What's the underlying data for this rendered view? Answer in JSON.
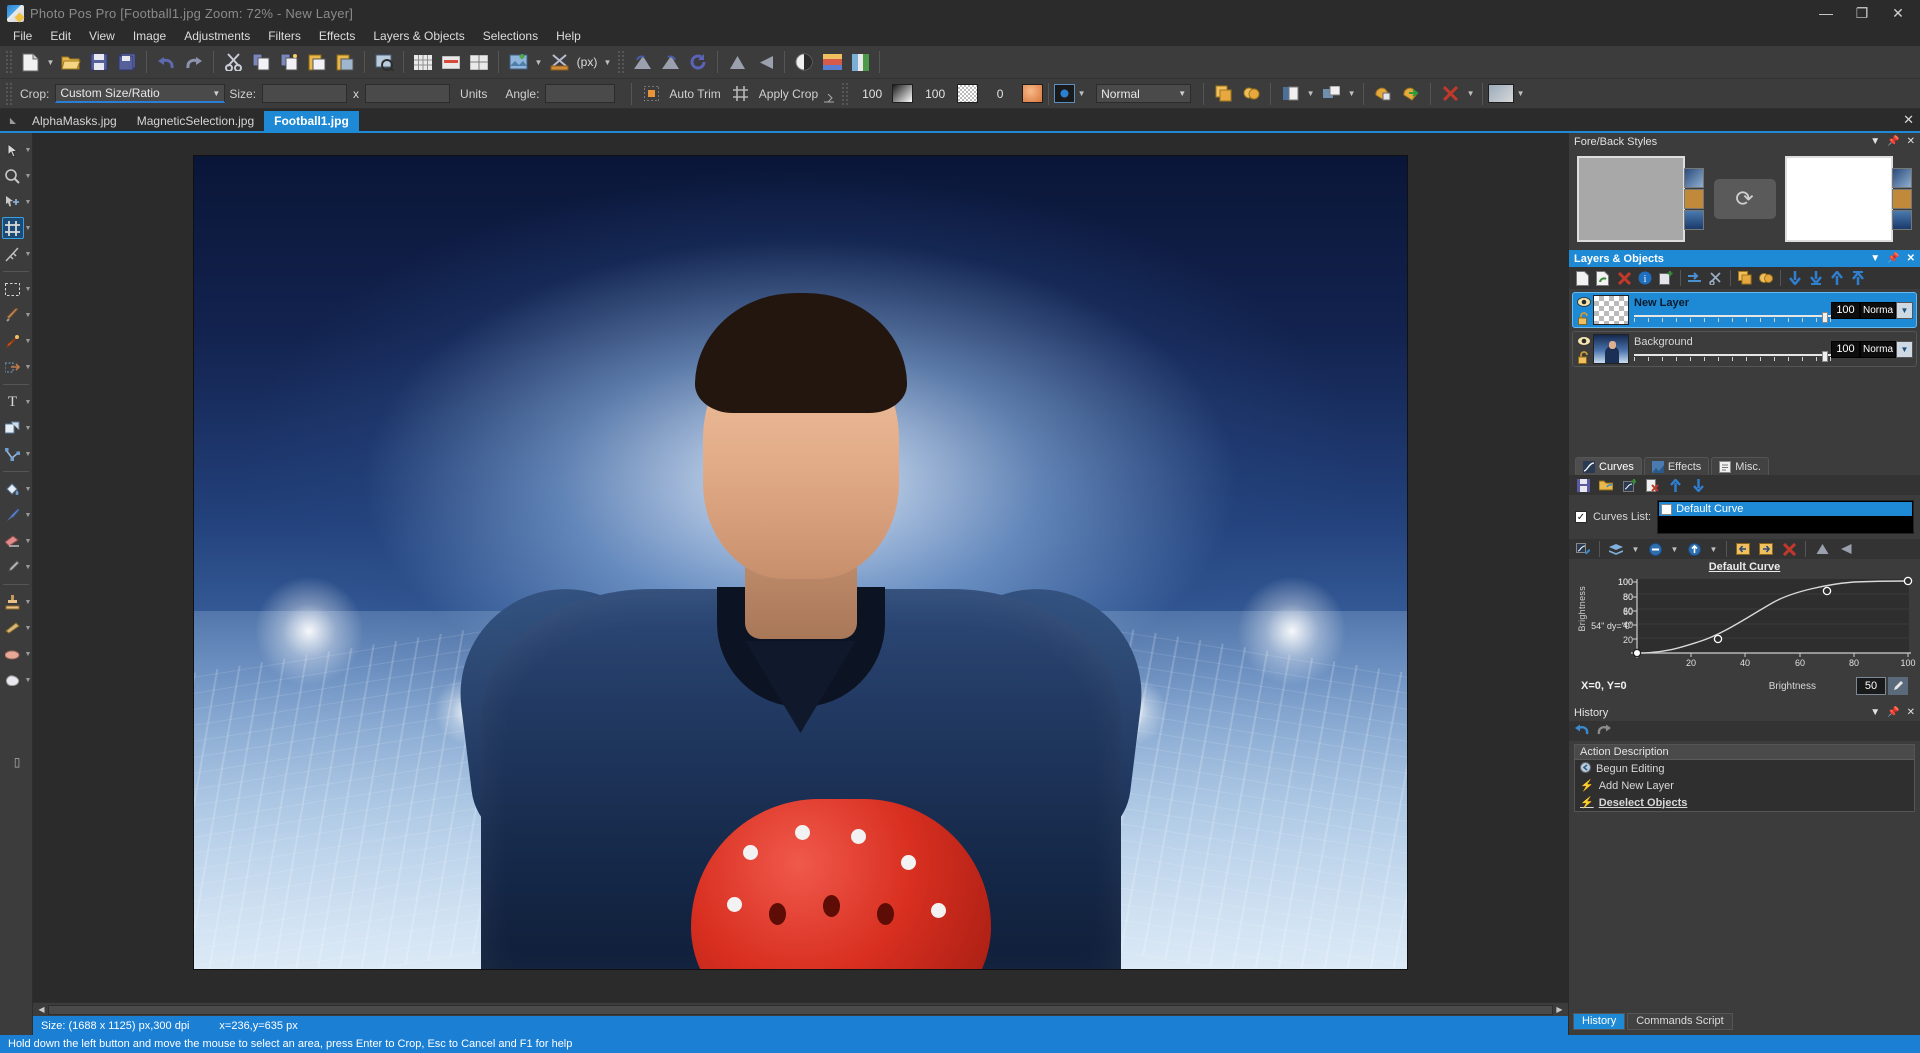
{
  "window": {
    "title": "Photo Pos Pro [Football1.jpg Zoom: 72% - New Layer]",
    "logo_icon": "app-logo-icon",
    "minimize": "—",
    "maximize": "❐",
    "close": "✕"
  },
  "menubar": {
    "items": [
      {
        "label": "File"
      },
      {
        "label": "Edit"
      },
      {
        "label": "View"
      },
      {
        "label": "Image"
      },
      {
        "label": "Adjustments"
      },
      {
        "label": "Filters"
      },
      {
        "label": "Effects"
      },
      {
        "label": "Layers & Objects"
      },
      {
        "label": "Selections"
      },
      {
        "label": "Help"
      }
    ]
  },
  "main_toolbar": {
    "buttons": [
      {
        "name": "new-file-icon",
        "glyph": "📄"
      },
      {
        "name": "open-file-icon",
        "glyph": "📂"
      },
      {
        "name": "save-icon",
        "glyph": "💾"
      },
      {
        "name": "save-as-icon",
        "glyph": "🗄"
      },
      {
        "name": "undo-icon",
        "glyph": "↶"
      },
      {
        "name": "redo-icon",
        "glyph": "↷"
      },
      {
        "name": "cut-icon",
        "glyph": "✂"
      },
      {
        "name": "copy-icon",
        "glyph": "📋"
      },
      {
        "name": "copy-merged-icon",
        "glyph": "📑"
      },
      {
        "name": "paste-icon",
        "glyph": "📌"
      },
      {
        "name": "paste-into-icon",
        "glyph": "📎"
      },
      {
        "name": "print-preview-icon",
        "glyph": "🔍"
      },
      {
        "name": "grid-icon",
        "glyph": "▦"
      },
      {
        "name": "ruler-icon",
        "glyph": "▭"
      },
      {
        "name": "guides-icon",
        "glyph": "⊞"
      },
      {
        "name": "image-effects-icon",
        "glyph": "🖼"
      },
      {
        "name": "crop-tool-icon",
        "glyph": "✂"
      },
      {
        "name": "units-px-icon",
        "glyph": "(px)"
      },
      {
        "name": "flip-rotate-icon",
        "glyph": "◣"
      },
      {
        "name": "rotate-left-icon",
        "glyph": "◢"
      },
      {
        "name": "rotate-cw-icon",
        "glyph": "↻"
      },
      {
        "name": "flip-vertical-icon",
        "glyph": "▲"
      },
      {
        "name": "flip-horizontal-icon",
        "glyph": "◀"
      },
      {
        "name": "contrast-icon",
        "glyph": "◐"
      },
      {
        "name": "gradient-icon",
        "glyph": "▬"
      },
      {
        "name": "color-balance-icon",
        "glyph": "▥"
      }
    ],
    "units_label": "(px)"
  },
  "crop_bar": {
    "crop_label": "Crop:",
    "crop_mode": "Custom Size/Ratio",
    "size_label": "Size:",
    "size_width": "",
    "size_x": "x",
    "size_height": "",
    "units_label": "Units",
    "angle_label": "Angle:",
    "angle_value": "",
    "auto_trim_label": "Auto Trim",
    "auto_trim_icon": "auto-trim-icon",
    "apply_crop_label": "Apply Crop",
    "apply_crop_icon": "apply-crop-icon",
    "opacity_value": "100",
    "feather_value": "100",
    "tolerance_value": "0",
    "blend_mode": "Normal",
    "fg_swatch": "#dfe8f0",
    "pattern_swatch": "#cfcfcf",
    "color_swatch": "#e8955a",
    "mask_swatch": "#2b7fd0",
    "right_icons": [
      {
        "name": "duplicate-selection-icon",
        "glyph": "⧉"
      },
      {
        "name": "merge-selection-icon",
        "glyph": "◓"
      },
      {
        "name": "selection-to-layer-icon",
        "glyph": "◧"
      },
      {
        "name": "transform-selection-icon",
        "glyph": "▣"
      },
      {
        "name": "save-selection-icon",
        "glyph": "💾"
      },
      {
        "name": "load-selection-icon",
        "glyph": "➜"
      },
      {
        "name": "delete-selection-icon",
        "glyph": "✕"
      },
      {
        "name": "selection-preview-icon",
        "glyph": "▨"
      }
    ]
  },
  "document_tabs": {
    "scroll_left_icon": "scroll-left-icon",
    "tabs": [
      {
        "label": "AlphaMasks.jpg",
        "active": false
      },
      {
        "label": "MagneticSelection.jpg",
        "active": false
      },
      {
        "label": "Football1.jpg",
        "active": true
      }
    ],
    "close_icon": "close-document-icon"
  },
  "tools": [
    {
      "name": "move-tool",
      "glyph": "⬉",
      "selected": false,
      "has_arrow": true
    },
    {
      "name": "zoom-tool",
      "glyph": "🔍",
      "selected": false,
      "has_arrow": true
    },
    {
      "name": "pan-tool",
      "glyph": "✥",
      "selected": false,
      "has_arrow": true
    },
    {
      "name": "crop-tool",
      "glyph": "⌗",
      "selected": true,
      "has_arrow": true
    },
    {
      "name": "measure-tool",
      "glyph": "⟋",
      "selected": false,
      "has_arrow": true
    },
    {
      "divider": true
    },
    {
      "name": "rectangle-select-tool",
      "glyph": "⬚",
      "selected": false,
      "has_arrow": true
    },
    {
      "name": "magic-wand-tool",
      "glyph": "🪄",
      "selected": false,
      "has_arrow": true
    },
    {
      "name": "magnetic-lasso-tool",
      "glyph": "🖋",
      "selected": false,
      "has_arrow": true
    },
    {
      "name": "refine-selection-tool",
      "glyph": "◳",
      "selected": false,
      "has_arrow": true
    },
    {
      "divider": true
    },
    {
      "name": "text-tool",
      "glyph": "T",
      "selected": false,
      "has_arrow": true
    },
    {
      "name": "shape-tool",
      "glyph": "❏",
      "selected": false,
      "has_arrow": true
    },
    {
      "name": "path-tool",
      "glyph": "⟍",
      "selected": false,
      "has_arrow": true
    },
    {
      "divider": true
    },
    {
      "name": "fill-bucket-tool",
      "glyph": "🪣",
      "selected": false,
      "has_arrow": true
    },
    {
      "name": "paintbrush-tool",
      "glyph": "🖌",
      "selected": false,
      "has_arrow": true
    },
    {
      "name": "eraser-tool",
      "glyph": "▱",
      "selected": false,
      "has_arrow": true
    },
    {
      "name": "eyedropper-tool",
      "glyph": "⚲",
      "selected": false,
      "has_arrow": true
    },
    {
      "divider": true
    },
    {
      "name": "clone-stamp-tool",
      "glyph": "⚱",
      "selected": false,
      "has_arrow": true
    },
    {
      "name": "blur-sharpen-tool",
      "glyph": "▬",
      "selected": false,
      "has_arrow": true
    },
    {
      "name": "dodge-burn-tool",
      "glyph": "☁",
      "selected": false,
      "has_arrow": true
    },
    {
      "name": "smudge-tool",
      "glyph": "☁",
      "selected": false,
      "has_arrow": true
    },
    {
      "divider": true
    },
    {
      "name": "quick-mask-tool",
      "glyph": "❙",
      "selected": false,
      "has_arrow": false
    }
  ],
  "canvas": {
    "image_name": "Football1.jpg",
    "zoom": "72%",
    "scroll_left_icon": "◀",
    "scroll_right_icon": "▶"
  },
  "size_bar": {
    "size_text": "Size: (1688 x 1125) px,300 dpi",
    "cursor_text": "x=236,y=635 px"
  },
  "fore_back": {
    "title": "Fore/Back Styles",
    "collapse_icon": "chevron-down-icon",
    "pin_icon": "pin-icon",
    "close_icon": "close-icon",
    "foreground_color": "#a8a8a8",
    "background_color": "#ffffff",
    "swap_icon": "swap-colors-icon"
  },
  "layers_panel": {
    "title": "Layers & Objects",
    "collapse_icon": "chevron-down-icon",
    "pin_icon": "pin-icon",
    "close_icon": "close-icon",
    "toolbar": [
      {
        "name": "new-layer-icon",
        "glyph": "📄"
      },
      {
        "name": "duplicate-layer-icon",
        "glyph": "⧉"
      },
      {
        "name": "delete-layer-icon",
        "glyph": "✕"
      },
      {
        "name": "layer-properties-icon",
        "glyph": "ⓘ"
      },
      {
        "name": "layer-from-selection-icon",
        "glyph": "❐"
      },
      {
        "name": "merge-down-icon",
        "glyph": "⇉"
      },
      {
        "name": "split-layer-icon",
        "glyph": "✂"
      },
      {
        "name": "group-layers-icon",
        "glyph": "▣"
      },
      {
        "name": "ungroup-layers-icon",
        "glyph": "◈"
      },
      {
        "name": "move-layer-down-icon",
        "glyph": "⇣"
      },
      {
        "name": "move-layer-bottom-icon",
        "glyph": "⇩"
      },
      {
        "name": "move-layer-up-icon",
        "glyph": "⇡"
      },
      {
        "name": "move-layer-top-icon",
        "glyph": "⇧"
      }
    ],
    "layers": [
      {
        "name": "New Layer",
        "selected": true,
        "visible_icon": "eye-icon",
        "lock_icon": "unlock-icon",
        "thumb_type": "checker",
        "opacity": "100",
        "blend_mode": "Norma",
        "dropdown_icon": "chevron-down-icon"
      },
      {
        "name": "Background",
        "selected": false,
        "visible_icon": "eye-icon",
        "lock_icon": "unlock-icon",
        "thumb_type": "photo",
        "opacity": "100",
        "blend_mode": "Norma",
        "dropdown_icon": "chevron-down-icon"
      }
    ]
  },
  "curves_panel": {
    "tabs": [
      {
        "label": "Curves",
        "icon": "curves-icon",
        "active": true
      },
      {
        "label": "Effects",
        "icon": "effects-icon",
        "active": false
      },
      {
        "label": "Misc.",
        "icon": "misc-icon",
        "active": false
      }
    ],
    "toolbar": [
      {
        "name": "save-curve-icon",
        "glyph": "💾"
      },
      {
        "name": "open-curve-icon",
        "glyph": "📂"
      },
      {
        "name": "add-curve-icon",
        "glyph": "➕"
      },
      {
        "name": "delete-curve-icon",
        "glyph": "🗑"
      },
      {
        "name": "move-curve-up-icon",
        "glyph": "⬆"
      },
      {
        "name": "move-curve-down-icon",
        "glyph": "⬇"
      }
    ],
    "curves_list_label": "Curves List:",
    "curves_list_checked": true,
    "curves": [
      {
        "label": "Default Curve",
        "selected": true
      }
    ],
    "bottom_toolbar": [
      {
        "name": "edit-curve-icon",
        "glyph": "✎"
      },
      {
        "name": "curve-channel-icon",
        "glyph": "☰"
      },
      {
        "name": "curve-input-icon",
        "glyph": "⊖"
      },
      {
        "name": "curve-output-icon",
        "glyph": "⊕"
      },
      {
        "name": "curve-prev-icon",
        "glyph": "⬅"
      },
      {
        "name": "curve-next-icon",
        "glyph": "➡"
      },
      {
        "name": "reset-curve-icon",
        "glyph": "✕"
      },
      {
        "name": "curve-flip-v-icon",
        "glyph": "▲"
      },
      {
        "name": "curve-flip-h-icon",
        "glyph": "◀"
      }
    ],
    "graph_title": "Default Curve",
    "coord_text": "X=0, Y=0",
    "brightness_label": "Brightness",
    "value": "50",
    "picker_icon": "color-picker-icon"
  },
  "chart_data": {
    "type": "line",
    "title": "Default Curve",
    "xlabel": "Brightness",
    "ylabel": "Brightness",
    "xlim": [
      0,
      100
    ],
    "ylim": [
      0,
      100
    ],
    "xticks": [
      20,
      40,
      60,
      80,
      100
    ],
    "yticks": [
      20,
      40,
      60,
      80,
      100
    ],
    "grid": true,
    "control_points": [
      {
        "x": 0,
        "y": 0
      },
      {
        "x": 30,
        "y": 14
      },
      {
        "x": 70,
        "y": 85
      },
      {
        "x": 100,
        "y": 100
      }
    ],
    "series": [
      {
        "name": "Default Curve",
        "x": [
          0,
          5,
          10,
          15,
          20,
          25,
          30,
          35,
          40,
          45,
          50,
          55,
          60,
          65,
          70,
          75,
          80,
          85,
          90,
          95,
          100
        ],
        "y": [
          0,
          0.6,
          1.8,
          3.6,
          6.0,
          9.4,
          14.0,
          20.5,
          28.5,
          37.5,
          48.0,
          58.5,
          68.0,
          77.5,
          85.0,
          90.0,
          93.5,
          96.0,
          97.8,
          99.0,
          100
        ]
      }
    ]
  },
  "history_panel": {
    "title": "History",
    "collapse_icon": "chevron-down-icon",
    "pin_icon": "pin-icon",
    "close_icon": "close-icon",
    "undo_icon": "undo-icon",
    "redo_icon": "redo-icon",
    "column_header": "Action Description",
    "entries": [
      {
        "label": "Begun Editing",
        "icon": "begin-icon",
        "current": false
      },
      {
        "label": "Add New Layer",
        "icon": "bolt-icon",
        "current": false
      },
      {
        "label": "Deselect Objects",
        "icon": "bolt-icon",
        "current": true
      }
    ],
    "bottom_tabs": [
      {
        "label": "History",
        "active": true
      },
      {
        "label": "Commands Script",
        "active": false
      }
    ]
  },
  "statusbar": {
    "message": "Hold down the left button and move the mouse to select an area, press Enter to Crop, Esc to Cancel and F1 for help"
  }
}
